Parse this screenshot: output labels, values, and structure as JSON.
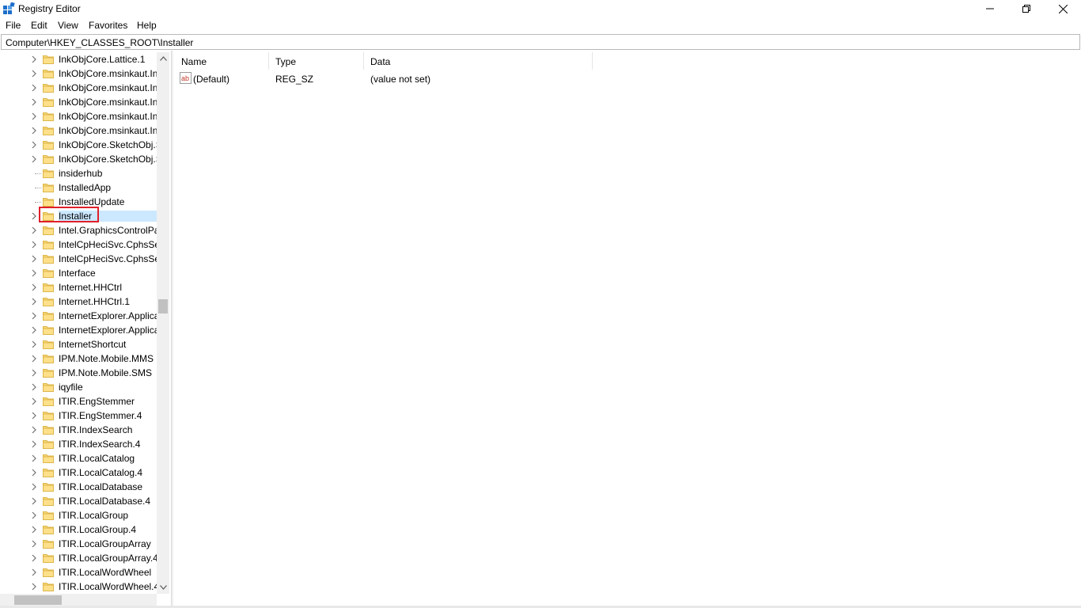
{
  "window": {
    "title": "Registry Editor",
    "controls": [
      "minimize",
      "restore",
      "close"
    ]
  },
  "menu": [
    "File",
    "Edit",
    "View",
    "Favorites",
    "Help"
  ],
  "address": "Computer\\HKEY_CLASSES_ROOT\\Installer",
  "tree": {
    "selected": "Installer",
    "items": [
      {
        "label": "InkObjCore.Lattice.1",
        "expandable": true
      },
      {
        "label": "InkObjCore.msinkaut.In",
        "expandable": true
      },
      {
        "label": "InkObjCore.msinkaut.In",
        "expandable": true
      },
      {
        "label": "InkObjCore.msinkaut.In",
        "expandable": true
      },
      {
        "label": "InkObjCore.msinkaut.In",
        "expandable": true
      },
      {
        "label": "InkObjCore.msinkaut.In",
        "expandable": true
      },
      {
        "label": "InkObjCore.SketchObj.S",
        "expandable": true
      },
      {
        "label": "InkObjCore.SketchObj.S",
        "expandable": true
      },
      {
        "label": "insiderhub",
        "expandable": false
      },
      {
        "label": "InstalledApp",
        "expandable": false
      },
      {
        "label": "InstalledUpdate",
        "expandable": false
      },
      {
        "label": "Installer",
        "expandable": true
      },
      {
        "label": "Intel.GraphicsControlPa",
        "expandable": true
      },
      {
        "label": "IntelCpHeciSvc.CphsSe",
        "expandable": true
      },
      {
        "label": "IntelCpHeciSvc.CphsSe",
        "expandable": true
      },
      {
        "label": "Interface",
        "expandable": true
      },
      {
        "label": "Internet.HHCtrl",
        "expandable": true
      },
      {
        "label": "Internet.HHCtrl.1",
        "expandable": true
      },
      {
        "label": "InternetExplorer.Applica",
        "expandable": true
      },
      {
        "label": "InternetExplorer.Applica",
        "expandable": true
      },
      {
        "label": "InternetShortcut",
        "expandable": true
      },
      {
        "label": "IPM.Note.Mobile.MMS",
        "expandable": true
      },
      {
        "label": "IPM.Note.Mobile.SMS",
        "expandable": true
      },
      {
        "label": "iqyfile",
        "expandable": true
      },
      {
        "label": "ITIR.EngStemmer",
        "expandable": true
      },
      {
        "label": "ITIR.EngStemmer.4",
        "expandable": true
      },
      {
        "label": "ITIR.IndexSearch",
        "expandable": true
      },
      {
        "label": "ITIR.IndexSearch.4",
        "expandable": true
      },
      {
        "label": "ITIR.LocalCatalog",
        "expandable": true
      },
      {
        "label": "ITIR.LocalCatalog.4",
        "expandable": true
      },
      {
        "label": "ITIR.LocalDatabase",
        "expandable": true
      },
      {
        "label": "ITIR.LocalDatabase.4",
        "expandable": true
      },
      {
        "label": "ITIR.LocalGroup",
        "expandable": true
      },
      {
        "label": "ITIR.LocalGroup.4",
        "expandable": true
      },
      {
        "label": "ITIR.LocalGroupArray",
        "expandable": true
      },
      {
        "label": "ITIR.LocalGroupArray.4",
        "expandable": true
      },
      {
        "label": "ITIR.LocalWordWheel",
        "expandable": true
      },
      {
        "label": "ITIR.LocalWordWheel.4",
        "expandable": true
      }
    ]
  },
  "values": {
    "columns": [
      "Name",
      "Type",
      "Data"
    ],
    "rows": [
      {
        "name": "(Default)",
        "type": "REG_SZ",
        "data": "(value not set)",
        "icon": "string-value-icon"
      }
    ]
  },
  "colors": {
    "selection_highlight": "#cce8ff",
    "annotation_box": "#e0202a",
    "folder": "#f8d775"
  }
}
